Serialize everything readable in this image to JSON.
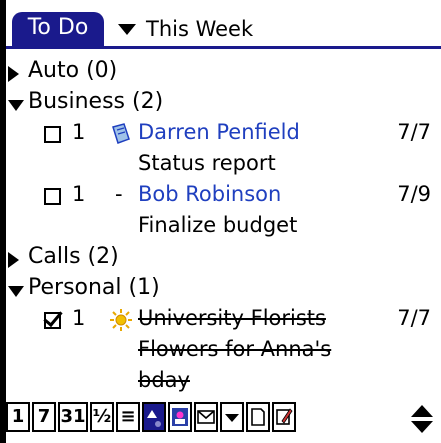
{
  "header": {
    "app_tab": "To Do",
    "category_selected": "This Week"
  },
  "categories": [
    {
      "name": "Auto (0)",
      "expanded": false,
      "items": []
    },
    {
      "name": "Business (2)",
      "expanded": true,
      "items": [
        {
          "checked": false,
          "priority": "1",
          "icon": "note-icon",
          "desc": "Darren Penfield",
          "date": "7/7",
          "note": "Status report",
          "done": false
        },
        {
          "checked": false,
          "priority": "1",
          "icon": "dash",
          "desc": "Bob Robinson",
          "date": "7/9",
          "note": "Finalize budget",
          "done": false
        }
      ]
    },
    {
      "name": "Calls (2)",
      "expanded": false,
      "items": []
    },
    {
      "name": "Personal (1)",
      "expanded": true,
      "items": [
        {
          "checked": true,
          "priority": "1",
          "icon": "sun-icon",
          "desc": "University Florists",
          "date": "7/7",
          "note": "Flowers for Anna's",
          "note2": "bday",
          "done": true
        }
      ]
    }
  ],
  "toolbar": {
    "buttons": [
      "1",
      "7",
      "31",
      "½",
      "≡",
      "",
      "",
      "",
      "",
      "",
      "",
      ""
    ]
  },
  "colors": {
    "accent": "#1a1a8c",
    "link": "#1f3fbf"
  }
}
